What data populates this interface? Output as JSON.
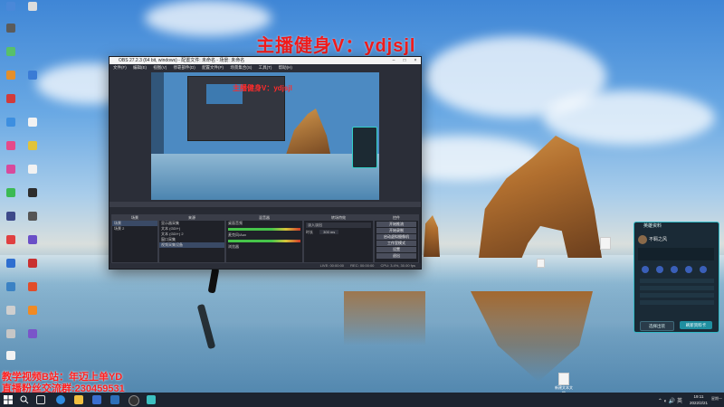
{
  "overlay": {
    "title": "主播健身V：ydjsjl",
    "bottom_line1": "教学视频B站：年迈上单YD",
    "bottom_line2": "直播粉丝交流群:230459531"
  },
  "obs": {
    "title": "OBS 27.2.3 (64 bit, windows) - 配置文件: 未命名 - 场景: 未命名",
    "menu": [
      "文件(F)",
      "编辑(E)",
      "视图(V)",
      "停靠部件(D)",
      "配置文件(P)",
      "场景集合(S)",
      "工具(T)",
      "帮助(H)"
    ],
    "preview_caption": "主播健身V：ydjsjl",
    "docks": {
      "scenes_header": "场景",
      "scenes": [
        "场景",
        "场景 2"
      ],
      "sources_header": "来源",
      "sources": [
        "显示器采集",
        "文本 (GDI+)",
        "文本 (GDI+) 2",
        "窗口采集",
        "视频采集设备"
      ],
      "mixer_header": "混音器",
      "mixer": [
        "桌面音频",
        "麦克风/Aux",
        "浏览器"
      ],
      "transitions_header": "转场特效",
      "transition_value": "淡入淡出",
      "duration_label": "时长",
      "duration_value": "300 ms",
      "controls_header": "控件",
      "controls": [
        "开始推流",
        "开始录制",
        "启动虚拟摄像机",
        "工作室模式",
        "设置",
        "退出"
      ]
    },
    "status": [
      "LIVE: 00:00:00",
      "REC: 00:00:00",
      "CPU: 3.4%, 30.00 fps"
    ]
  },
  "widget": {
    "title": "英雄资料",
    "name": "不羁之风",
    "button_left": "选择出装",
    "button_right": "刷新资料卡"
  },
  "desktop_file": "新建文本文档",
  "taskbar": {
    "time": "19:11",
    "date": "2022/2/21",
    "day": "星期一"
  },
  "icons": {
    "start": "windows-start-icon",
    "search": "search-icon",
    "task_view": "task-view-icon",
    "edge": "browser-icon",
    "explorer": "folder-icon",
    "store": "store-icon",
    "mail": "mail-icon",
    "obs": "obs-icon",
    "game": "game-client-icon"
  },
  "colors": {
    "overlay_red": "#f21c1c",
    "obs_bg": "#2b2e38",
    "widget_accent": "#2fb8c4",
    "taskbar": "#1c2430"
  }
}
